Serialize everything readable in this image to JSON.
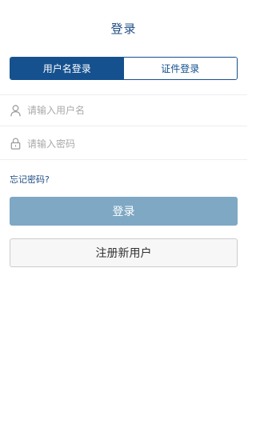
{
  "header": {
    "title": "登录"
  },
  "tabs": [
    {
      "label": "用户名登录",
      "active": true
    },
    {
      "label": "证件登录",
      "active": false
    }
  ],
  "form": {
    "username": {
      "icon": "user-icon",
      "value": "",
      "placeholder": "请输入用户名"
    },
    "password": {
      "icon": "lock-icon",
      "value": "",
      "placeholder": "请输入密码"
    }
  },
  "forgot_password_label": "忘记密码?",
  "login_button_label": "登录",
  "register_button_label": "注册新用户",
  "colors": {
    "primary": "#15518f",
    "title": "#1f4e85",
    "login_button_disabled": "#7ea8c4",
    "placeholder": "#aaaaaa"
  }
}
